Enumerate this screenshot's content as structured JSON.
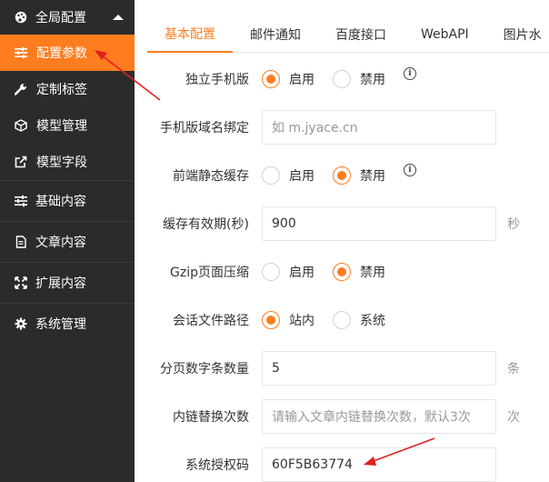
{
  "sidebar": {
    "header": {
      "label": "全局配置",
      "icon": "palette-icon"
    },
    "items": [
      {
        "label": "配置参数",
        "icon": "sliders-icon",
        "active": true
      },
      {
        "label": "定制标签",
        "icon": "wrench-icon"
      },
      {
        "label": "模型管理",
        "icon": "cube-icon"
      },
      {
        "label": "模型字段",
        "icon": "external-link-icon"
      }
    ],
    "groups": [
      {
        "label": "基础内容",
        "icon": "sliders-icon"
      },
      {
        "label": "文章内容",
        "icon": "document-icon"
      },
      {
        "label": "扩展内容",
        "icon": "expand-icon"
      },
      {
        "label": "系统管理",
        "icon": "gear-icon"
      }
    ]
  },
  "tabs": [
    "基本配置",
    "邮件通知",
    "百度接口",
    "WebAPI",
    "图片水"
  ],
  "form": {
    "mobile": {
      "label": "独立手机版",
      "opt1": "启用",
      "opt2": "禁用"
    },
    "mobile_domain": {
      "label": "手机版域名绑定",
      "placeholder": "如 m.jyace.cn"
    },
    "static_cache": {
      "label": "前端静态缓存",
      "opt1": "启用",
      "opt2": "禁用"
    },
    "cache_expire": {
      "label": "缓存有效期(秒)",
      "value": "900",
      "unit": "秒"
    },
    "gzip": {
      "label": "Gzip页面压缩",
      "opt1": "启用",
      "opt2": "禁用"
    },
    "session_path": {
      "label": "会话文件路径",
      "opt1": "站内",
      "opt2": "系统"
    },
    "page_num": {
      "label": "分页数字条数量",
      "value": "5",
      "unit": "条"
    },
    "link_replace": {
      "label": "内链替换次数",
      "placeholder": "请输入文章内链替换次数，默认3次",
      "unit": "次"
    },
    "license": {
      "label": "系统授权码",
      "value": "60F5B63774"
    }
  },
  "colors": {
    "accent": "#ff7c1f",
    "sidebar_bg": "#2b2b2b",
    "arrow": "#e02020"
  }
}
